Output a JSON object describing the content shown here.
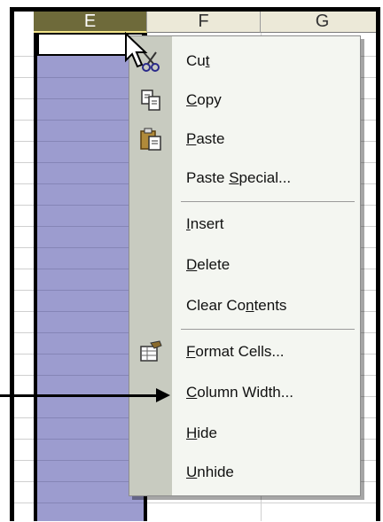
{
  "columns": [
    {
      "letter": "E",
      "selected": true
    },
    {
      "letter": "F",
      "selected": false
    },
    {
      "letter": "G",
      "selected": false
    }
  ],
  "context_menu": {
    "items": [
      {
        "pre": "Cu",
        "key": "t",
        "post": "",
        "icon": "scissors-icon"
      },
      {
        "pre": "",
        "key": "C",
        "post": "opy",
        "icon": "copy-icon"
      },
      {
        "pre": "",
        "key": "P",
        "post": "aste",
        "icon": "clipboard-icon"
      },
      {
        "pre": "Paste ",
        "key": "S",
        "post": "pecial...",
        "icon": ""
      },
      {
        "pre": "",
        "key": "I",
        "post": "nsert",
        "icon": ""
      },
      {
        "pre": "",
        "key": "D",
        "post": "elete",
        "icon": ""
      },
      {
        "pre": "Clear Co",
        "key": "n",
        "post": "tents",
        "icon": ""
      },
      {
        "pre": "",
        "key": "F",
        "post": "ormat Cells...",
        "icon": "format-cells-icon"
      },
      {
        "pre": "",
        "key": "C",
        "post": "olumn Width...",
        "icon": ""
      },
      {
        "pre": "",
        "key": "H",
        "post": "ide",
        "icon": ""
      },
      {
        "pre": "",
        "key": "U",
        "post": "nhide",
        "icon": ""
      }
    ]
  },
  "colors": {
    "selected_column_fill": "#9c9ccf",
    "selected_header": "#6e6a3a",
    "menu_background": "#f4f6f1",
    "menu_gutter": "#c8cbc0"
  }
}
